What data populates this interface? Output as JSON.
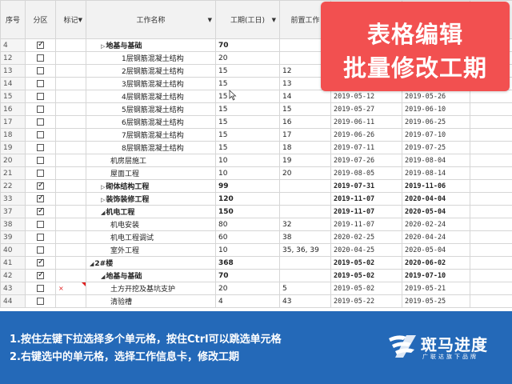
{
  "columns": {
    "seq": "序号",
    "zone": "分区",
    "mark": "标记",
    "name": "工作名称",
    "duration": "工期(工日)",
    "pred": "前置工作"
  },
  "rows": [
    {
      "seq": "4",
      "cb": true,
      "name": "地基与基础",
      "indent": 1,
      "tri": "▷",
      "bold": true,
      "dur": "70",
      "pred": "",
      "start": "",
      "end": ""
    },
    {
      "seq": "12",
      "cb": false,
      "name": "1层钢筋混凝土结构",
      "indent": 3,
      "tri": "",
      "bold": false,
      "dur": "20",
      "pred": "",
      "start": "",
      "end": ""
    },
    {
      "seq": "13",
      "cb": false,
      "name": "2层钢筋混凝土结构",
      "indent": 3,
      "tri": "",
      "bold": false,
      "dur": "15",
      "pred": "12",
      "start": "",
      "end": ""
    },
    {
      "seq": "14",
      "cb": false,
      "name": "3层钢筋混凝土结构",
      "indent": 3,
      "tri": "",
      "bold": false,
      "dur": "15",
      "pred": "13",
      "start": "",
      "end": ""
    },
    {
      "seq": "15",
      "cb": false,
      "name": "4层钢筋混凝土结构",
      "indent": 3,
      "tri": "",
      "bold": false,
      "dur": "15",
      "pred": "14",
      "start": "2019-05-12",
      "end": "2019-05-26"
    },
    {
      "seq": "16",
      "cb": false,
      "name": "5层钢筋混凝土结构",
      "indent": 3,
      "tri": "",
      "bold": false,
      "dur": "15",
      "pred": "15",
      "start": "2019-05-27",
      "end": "2019-06-10"
    },
    {
      "seq": "17",
      "cb": false,
      "name": "6层钢筋混凝土结构",
      "indent": 3,
      "tri": "",
      "bold": false,
      "dur": "15",
      "pred": "16",
      "start": "2019-06-11",
      "end": "2019-06-25"
    },
    {
      "seq": "18",
      "cb": false,
      "name": "7层钢筋混凝土结构",
      "indent": 3,
      "tri": "",
      "bold": false,
      "dur": "15",
      "pred": "17",
      "start": "2019-06-26",
      "end": "2019-07-10"
    },
    {
      "seq": "19",
      "cb": false,
      "name": "8层钢筋混凝土结构",
      "indent": 3,
      "tri": "",
      "bold": false,
      "dur": "15",
      "pred": "18",
      "start": "2019-07-11",
      "end": "2019-07-25"
    },
    {
      "seq": "20",
      "cb": false,
      "name": "机房层施工",
      "indent": 2,
      "tri": "",
      "bold": false,
      "dur": "10",
      "pred": "19",
      "start": "2019-07-26",
      "end": "2019-08-04"
    },
    {
      "seq": "21",
      "cb": false,
      "name": "屋面工程",
      "indent": 2,
      "tri": "",
      "bold": false,
      "dur": "10",
      "pred": "20",
      "start": "2019-08-05",
      "end": "2019-08-14"
    },
    {
      "seq": "22",
      "cb": true,
      "name": "砌体结构工程",
      "indent": 1,
      "tri": "▷",
      "bold": true,
      "dur": "99",
      "pred": "",
      "start": "2019-07-31",
      "end": "2019-11-06"
    },
    {
      "seq": "33",
      "cb": true,
      "name": "装饰装修工程",
      "indent": 1,
      "tri": "▷",
      "bold": true,
      "dur": "120",
      "pred": "",
      "start": "2019-11-07",
      "end": "2020-04-04"
    },
    {
      "seq": "37",
      "cb": true,
      "name": "机电工程",
      "indent": 1,
      "tri": "◢",
      "bold": true,
      "dur": "150",
      "pred": "",
      "start": "2019-11-07",
      "end": "2020-05-04"
    },
    {
      "seq": "38",
      "cb": false,
      "name": "机电安装",
      "indent": 2,
      "tri": "",
      "bold": false,
      "dur": "80",
      "pred": "32",
      "start": "2019-11-07",
      "end": "2020-02-24"
    },
    {
      "seq": "39",
      "cb": false,
      "name": "机电工程调试",
      "indent": 2,
      "tri": "",
      "bold": false,
      "dur": "60",
      "pred": "38",
      "start": "2020-02-25",
      "end": "2020-04-24"
    },
    {
      "seq": "40",
      "cb": false,
      "name": "室外工程",
      "indent": 2,
      "tri": "",
      "bold": false,
      "dur": "10",
      "pred": "35, 36, 39",
      "start": "2020-04-25",
      "end": "2020-05-04"
    },
    {
      "seq": "41",
      "cb": true,
      "name": "2#楼",
      "indent": 0,
      "tri": "◢",
      "bold": true,
      "dur": "368",
      "pred": "",
      "start": "2019-05-02",
      "end": "2020-06-02"
    },
    {
      "seq": "42",
      "cb": true,
      "name": "地基与基础",
      "indent": 1,
      "tri": "◢",
      "bold": true,
      "dur": "70",
      "pred": "",
      "start": "2019-05-02",
      "end": "2019-07-10"
    },
    {
      "seq": "43",
      "cb": false,
      "name": "土方开挖及基坑支护",
      "indent": 2,
      "tri": "",
      "bold": false,
      "dur": "20",
      "pred": "5",
      "start": "2019-05-02",
      "end": "2019-05-21",
      "mark": "×",
      "flag": true
    },
    {
      "seq": "44",
      "cb": false,
      "name": "清验槽",
      "indent": 2,
      "tri": "",
      "bold": false,
      "dur": "4",
      "pred": "43",
      "start": "2019-05-22",
      "end": "2019-05-25"
    }
  ],
  "banner": {
    "line1": "表格编辑",
    "line2": "批量修改工期"
  },
  "footer": {
    "tip1": "1.按住左键下拉选择多个单元格，按住Ctrl可以跳选单元格",
    "tip2": "2.右键选中的单元格，选择工作信息卡，修改工期",
    "brand": "斑马进度",
    "slogan": "广联达旗下品牌"
  },
  "colors": {
    "banner": "#f25050",
    "footer": "#2469b8",
    "header": "#f2f2f2"
  }
}
